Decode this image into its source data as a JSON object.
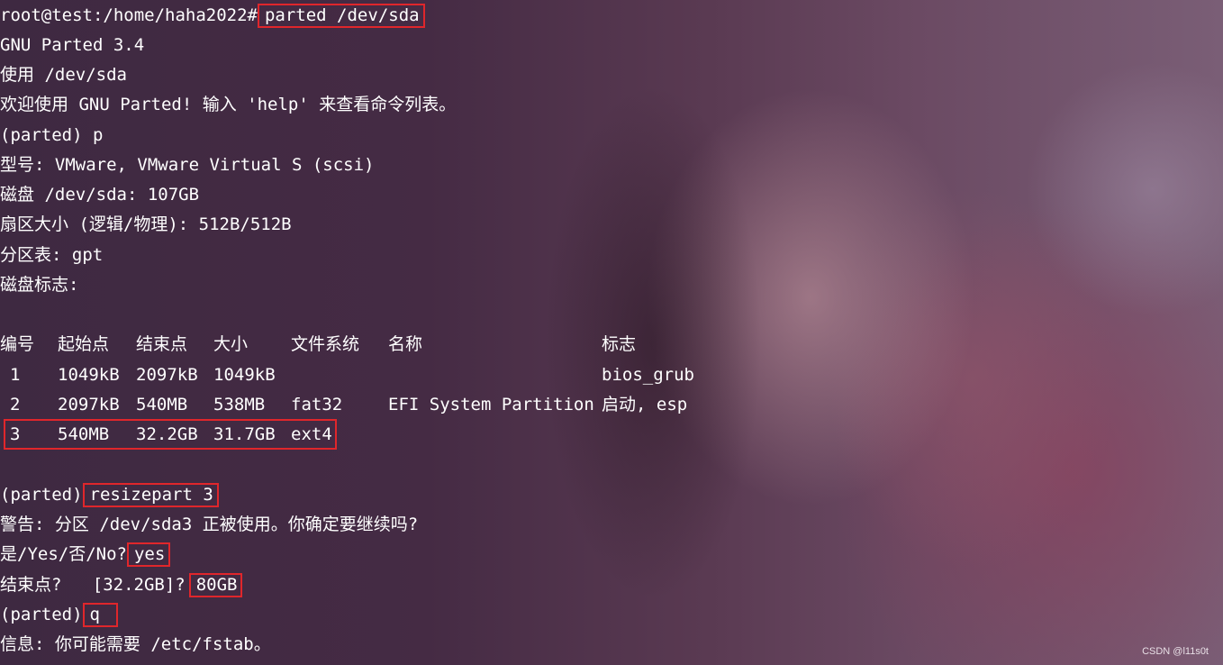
{
  "terminal": {
    "prompt": "root@test:/home/haha2022#",
    "command": "parted /dev/sda",
    "lines": {
      "version": "GNU Parted 3.4",
      "using": "使用 /dev/sda",
      "welcome": "欢迎使用 GNU Parted! 输入 'help' 来查看命令列表。",
      "print_cmd": "(parted) p",
      "model": "型号: VMware, VMware Virtual S (scsi)",
      "disk": "磁盘 /dev/sda: 107GB",
      "sector_size": "扇区大小 (逻辑/物理): 512B/512B",
      "partition_table": "分区表: gpt",
      "disk_flags": "磁盘标志:"
    },
    "table": {
      "headers": [
        "编号",
        "起始点",
        "结束点",
        "大小",
        "文件系统",
        "名称",
        "标志"
      ],
      "rows": [
        [
          "1",
          "1049kB",
          "2097kB",
          "1049kB",
          "",
          "",
          "bios_grub"
        ],
        [
          "2",
          "2097kB",
          "540MB",
          "538MB",
          "fat32",
          "EFI System Partition",
          "启动, esp"
        ],
        [
          "3",
          "540MB",
          "32.2GB",
          "31.7GB",
          "ext4",
          "",
          ""
        ]
      ]
    },
    "resize": {
      "prompt": "(parted)",
      "command": "resizepart 3",
      "warning": "警告: 分区 /dev/sda3 正被使用。你确定要继续吗?",
      "confirm_prompt": "是/Yes/否/No?",
      "confirm_answer": "yes",
      "end_prompt": "结束点?   [32.2GB]?",
      "end_answer": "80GB",
      "quit_prompt": "(parted)",
      "quit_command": "q",
      "info": "信息: 你可能需要 /etc/fstab。"
    }
  },
  "watermark": "CSDN @l11s0t",
  "colors": {
    "highlight_border": "#e0262b",
    "text": "#ffffff"
  }
}
